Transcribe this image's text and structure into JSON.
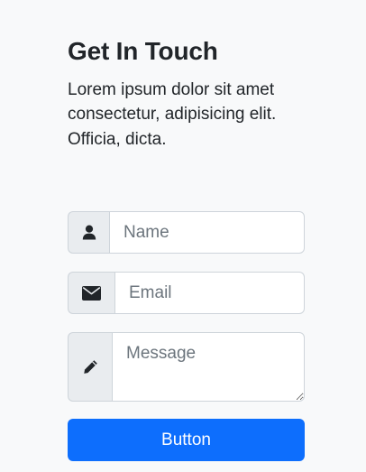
{
  "contact": {
    "title": "Get In Touch",
    "description": "Lorem ipsum dolor sit amet consectetur, adipisicing elit. Officia, dicta."
  },
  "form": {
    "name_placeholder": "Name",
    "email_placeholder": "Email",
    "message_placeholder": "Message",
    "submit_label": "Button"
  },
  "icons": {
    "name": "user-icon",
    "email": "envelope-icon",
    "message": "pencil-icon"
  },
  "colors": {
    "background": "#f8f9fa",
    "addon_background": "#e9ecef",
    "border": "#ced4da",
    "button": "#0d6efd",
    "button_text": "#ffffff",
    "text": "#212529",
    "placeholder": "#6c757d"
  }
}
